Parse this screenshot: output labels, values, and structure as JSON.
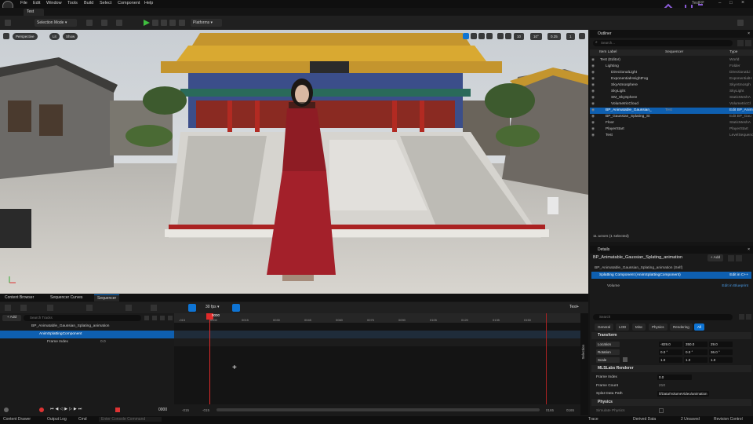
{
  "window": {
    "title": "TestFP"
  },
  "menubar": [
    "File",
    "Edit",
    "Window",
    "Tools",
    "Build",
    "Select",
    "Component",
    "Help"
  ],
  "doc_tab": "Test",
  "toolbar": {
    "selection_mode": "Selection Mode",
    "platforms": "Platforms"
  },
  "viewport": {
    "perspective": "Perspective",
    "lit": "Lit",
    "show": "Show",
    "grid_value": "10",
    "angle_value": "10°",
    "scale_value": "0.25",
    "cam_speed": "1"
  },
  "outliner": {
    "title": "Outliner",
    "search_placeholder": "Search...",
    "columns": {
      "label": "Item Label",
      "sequencer": "Sequencer",
      "type": "Type"
    },
    "rows": [
      {
        "name": "Test (Editor)",
        "seq": "",
        "type": "World",
        "indent": 1
      },
      {
        "name": "Lighting",
        "seq": "",
        "type": "Folder",
        "indent": 2
      },
      {
        "name": "DirectionalLight",
        "seq": "",
        "type": "DirectionalLi",
        "indent": 3
      },
      {
        "name": "ExponentialHeightFog",
        "seq": "",
        "type": "ExponentialH",
        "indent": 3
      },
      {
        "name": "SkyAtmosphere",
        "seq": "",
        "type": "SkyAtmosph",
        "indent": 3
      },
      {
        "name": "SkyLight",
        "seq": "",
        "type": "SkyLight",
        "indent": 3
      },
      {
        "name": "SM_SkySphere",
        "seq": "",
        "type": "StaticMeshA",
        "indent": 3
      },
      {
        "name": "VolumetricCloud",
        "seq": "",
        "type": "VolumetricCl",
        "indent": 3
      },
      {
        "name": "BP_Animatable_Gaussian_",
        "seq": "Test",
        "type": "Edit BP_Anim",
        "indent": 2,
        "selected": true
      },
      {
        "name": "BP_Gaussian_Splating_St",
        "seq": "",
        "type": "Edit BP_Gau",
        "indent": 2
      },
      {
        "name": "Floor",
        "seq": "",
        "type": "StaticMeshA",
        "indent": 2
      },
      {
        "name": "PlayerStart",
        "seq": "",
        "type": "PlayerStart",
        "indent": 2
      },
      {
        "name": "Test",
        "seq": "",
        "type": "LevelSequenc",
        "indent": 2
      }
    ],
    "footer": "11 actors (1 selected)"
  },
  "details": {
    "title": "Details",
    "actor_name": "BP_Animatable_Gaussian_Splating_animation",
    "add_label": "+ Add",
    "self_row": "BP_Animatable_Gaussian_Splating_animation (Self)",
    "component_row": "Splatting Component (AnimSplattingComponent)",
    "edit_cpp": "Edit in C++",
    "volume_row": "Volume",
    "edit_bp": "Edit in Blueprint",
    "search_placeholder": "Search",
    "filter_tabs": [
      "General",
      "LOD",
      "Misc",
      "Physics",
      "Rendering",
      "All"
    ],
    "transform": {
      "section": "Transform",
      "location_label": "Location",
      "location": [
        "-829.0",
        "350.0",
        "29.0"
      ],
      "rotation_label": "Rotation",
      "rotation": [
        "0.0 °",
        "0.0 °",
        "36.0 °"
      ],
      "scale_label": "Scale",
      "scale": [
        "1.0",
        "1.0",
        "1.0"
      ]
    },
    "mlslabs": {
      "section": "MLSLabs Renderer",
      "frame_index_label": "Frame Index",
      "frame_index": "0.0",
      "frame_count_label": "Frame Count",
      "frame_count": "210",
      "splat_path_label": "Splat Data Path",
      "splat_path": "/l/Data/VolumeVideo/animation"
    },
    "physics": {
      "section": "Physics",
      "simulate_label": "Simulate Physics"
    }
  },
  "bottom_tabs": [
    "Content Browser",
    "Sequencer Curves",
    "Sequencer"
  ],
  "sequencer": {
    "add_label": "+ Add",
    "search_placeholder": "Search Tracks",
    "fps": "30 fps",
    "seq_name": "Test+",
    "current_frame": "0000",
    "start_frame": "0000",
    "tracks": [
      {
        "name": "BP_Animatable_Gaussian_Splating_animation",
        "indent": 1
      },
      {
        "name": "AnimSplattingComponent",
        "indent": 2,
        "selected": true
      },
      {
        "name": "Frame Index",
        "value": "0.0",
        "indent": 3
      }
    ],
    "ruler_labels": [
      "-015",
      "0000",
      "0015",
      "0030",
      "0045",
      "0060",
      "0075",
      "0090",
      "0105",
      "0120",
      "0135",
      "0150"
    ],
    "range_left": [
      "-015",
      "-015"
    ],
    "range_right": [
      "0165",
      "0165"
    ],
    "side_label": "Selection"
  },
  "statusbar": {
    "items": [
      "Content Drawer",
      "Output Log",
      "Cmd"
    ],
    "console_placeholder": "Enter Console Command",
    "right": [
      "Trace",
      "Derived Data",
      "2 Unsaved",
      "Revision Control"
    ]
  },
  "colors": {
    "accent": "#0e74d4",
    "playhead": "#e02a2a",
    "selection": "#0e5fb0"
  }
}
